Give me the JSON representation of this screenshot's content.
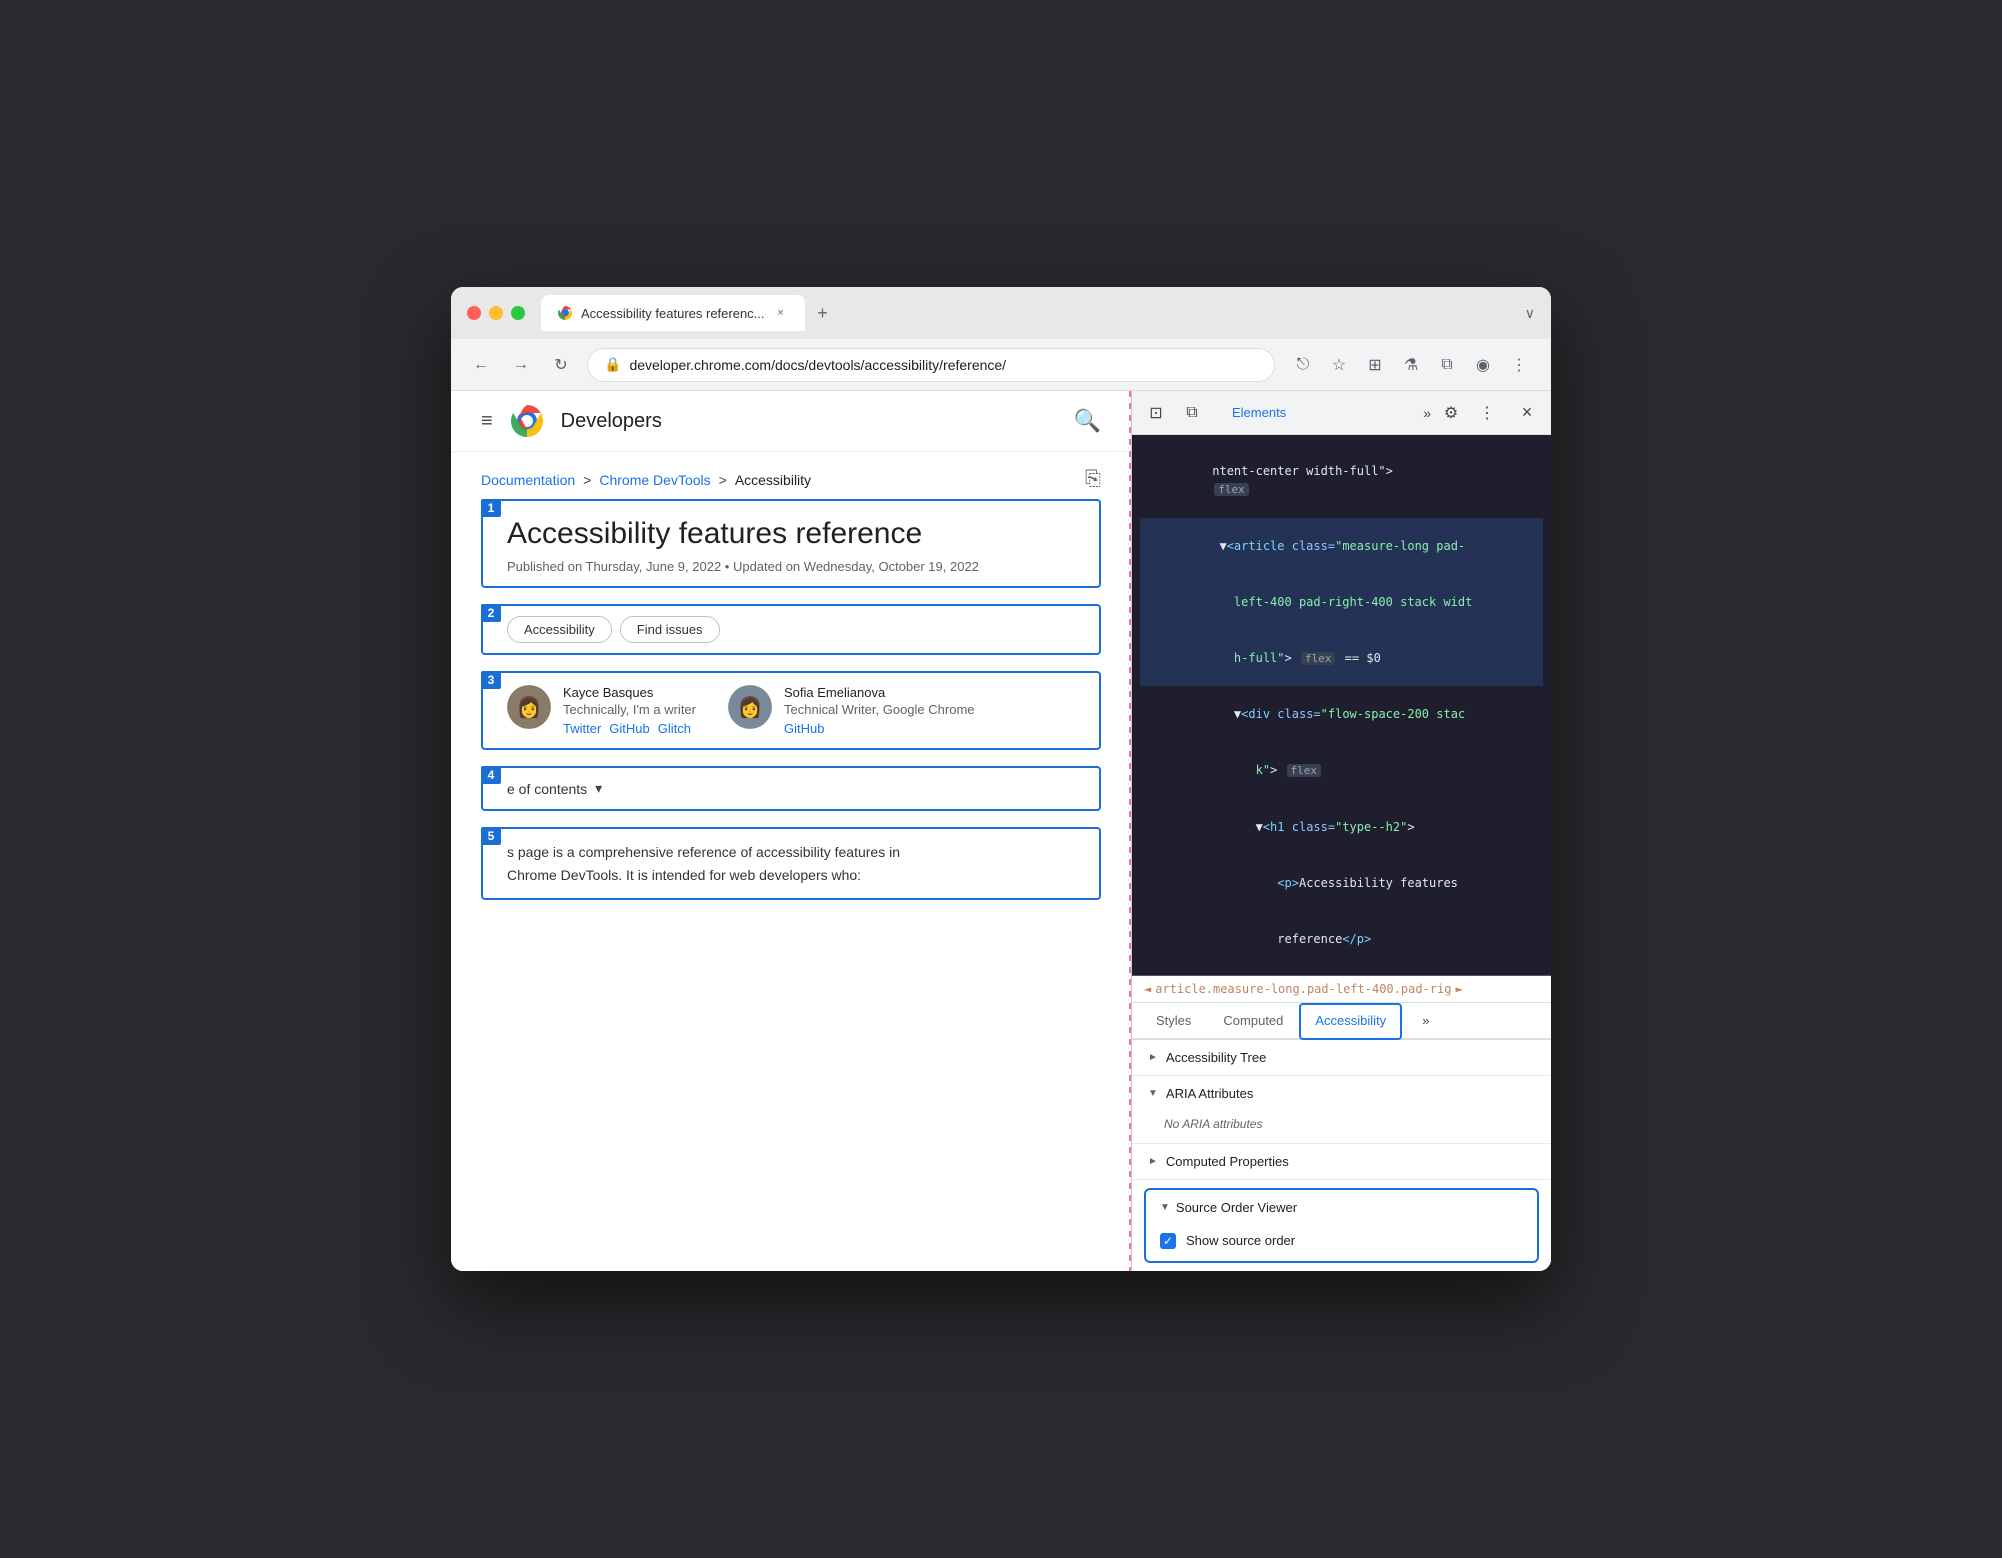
{
  "window": {
    "tab_title": "Accessibility features referenc...",
    "tab_close": "×",
    "tab_new": "+",
    "chevron_down": "∨"
  },
  "addressbar": {
    "back": "←",
    "forward": "→",
    "reload": "↻",
    "url": "developer.chrome.com/docs/devtools/accessibility/reference/",
    "share_icon": "⎋",
    "star_icon": "☆",
    "extension_icon": "⊞",
    "account_icon": "◉",
    "menu_icon": "⋮"
  },
  "webpage": {
    "hamburger": "≡",
    "brand": "Developers",
    "search_icon": "🔍",
    "breadcrumb": {
      "doc": "Documentation",
      "sep1": ">",
      "devtools": "Chrome DevTools",
      "sep2": ">",
      "current": "Accessibility",
      "share": "⎘"
    },
    "blocks": [
      {
        "num": "1",
        "title": "Accessibility features reference",
        "subtitle": "Published on Thursday, June 9, 2022 • Updated on Wednesday, October 19, 2022"
      },
      {
        "num": "2",
        "tabs": [
          "Accessibility",
          "Find issues"
        ]
      },
      {
        "num": "3",
        "authors": [
          {
            "name": "Kayce Basques",
            "title": "Technically, I'm a writer",
            "links": [
              "Twitter",
              "GitHub",
              "Glitch"
            ]
          },
          {
            "name": "Sofia Emelianova",
            "title": "Technical Writer, Google Chrome",
            "links": [
              "GitHub"
            ]
          }
        ]
      },
      {
        "num": "4",
        "toc_text": "e of contents",
        "toc_chevron": "▾"
      },
      {
        "num": "5",
        "desc_line1": "s page is a comprehensive reference of accessibility features in",
        "desc_line2": "Chrome DevTools. It is intended for web developers who:"
      }
    ]
  },
  "devtools": {
    "toolbar": {
      "inspect_icon": "⊡",
      "device_icon": "⧉",
      "more_icon": "»",
      "gear_icon": "⚙",
      "menu_icon": "⋮",
      "close_icon": "×"
    },
    "panel_tabs": [
      "Elements"
    ],
    "more_tabs": "»",
    "elements_code": [
      {
        "text": "ntent-center width-full\">",
        "badge": "flex"
      },
      {
        "text": "▼<article class=\"measure-long pad-\n  left-400 pad-right-400 stack widt\n  h-full\">",
        "badge": "flex",
        "equals": "== $0"
      },
      {
        "text": "  ▼<div class=\"flow-space-200 stac\n    k\">",
        "badge": "flex"
      },
      {
        "text": "    ▼<h1 class=\"type--h2\">"
      },
      {
        "text": "      <p>Accessibility features\n      reference</p>"
      }
    ],
    "element_breadcrumb": "article.measure-long.pad-left-400.pad-rig",
    "bc_arrows": [
      "◄",
      "►"
    ],
    "subtabs": [
      "Styles",
      "Computed",
      "Accessibility",
      "»"
    ],
    "acc_sections": [
      {
        "id": "accessibility-tree",
        "label": "Accessibility Tree",
        "expanded": false,
        "triangle": "►"
      },
      {
        "id": "aria-attributes",
        "label": "ARIA Attributes",
        "expanded": true,
        "triangle": "▼",
        "content": "No ARIA attributes"
      },
      {
        "id": "computed-properties",
        "label": "Computed Properties",
        "expanded": false,
        "triangle": "►"
      }
    ],
    "source_order_viewer": {
      "label": "Source Order Viewer",
      "triangle": "▼",
      "show_source_order_label": "Show source order",
      "checked": true
    }
  }
}
